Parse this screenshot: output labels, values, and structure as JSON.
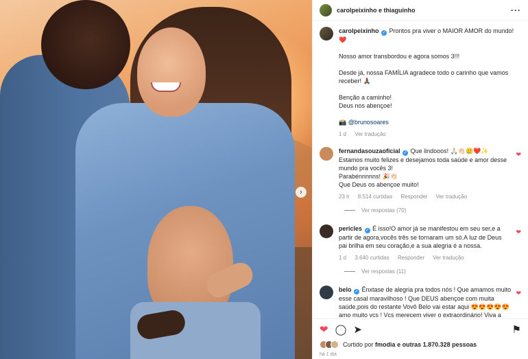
{
  "header": {
    "username": "carolpeixinho e thiaguinho",
    "more": "···"
  },
  "caption": {
    "username": "carolpeixinho",
    "line1": "Prontos pra viver o MAIOR AMOR do mundo!",
    "line1_emoji": "❤️",
    "para2": "Nosso amor transbordou e agora somos 3!!!",
    "para3": "Desde já, nossa FAMÍLIA agradece todo o carinho que vamos receber! 🙏🏾",
    "para4a": "Benção a caminho!",
    "para4b": "Deus nos abençoe!",
    "credit_icon": "📸",
    "credit": "@brunosoares",
    "time": "1 d",
    "see_translation": "Ver tradução"
  },
  "comments": [
    {
      "username": "fernandasouzaoficial",
      "text": "Que lindooos! 🙏🏻👏🏻🥲❤️✨",
      "lines": [
        "Estamos muito felizes e desejamos toda saúde e amor desse mundo pra vocês 3!",
        "Parabénnnnns! 🎉👏🏻",
        "Que Deus os abençoe muito!"
      ],
      "time": "23 h",
      "likes": "8.514 curtidas",
      "reply": "Responder",
      "translate": "Ver tradução",
      "replies": "Ver respostas (70)",
      "avatar_color": "#c98a5c"
    },
    {
      "username": "pericles",
      "text": "É isso!O amor já se manifestou em seu ser,e a partir de agora,vocês três se tornaram um só.A luz de Deus pai brilha em seu coração,e a sua alegria é a nossa.",
      "time": "1 d",
      "likes": "3.640 curtidas",
      "reply": "Responder",
      "translate": "Ver tradução",
      "replies": "Ver respostas (11)",
      "avatar_color": "#3b2b26"
    },
    {
      "username": "belo",
      "text": "Ênxtase de alegria pra todos nós ! Que amamos muito esse casal maravilhoso ! Que DEUS abençoe com muita saúde,pois do restante Vovô Belo vai estar aqui 😍😍😍😍😍 amo muito vcs ! Vcs merecem viver o extraordinário! Viva a família TH e Peixinho ! 😍❤️😍",
      "avatar_color": "#2f3b47"
    }
  ],
  "likes": {
    "prefix": "Curtido por",
    "user": "fmodia",
    "suffix": "e outras 1.870.328 pessoas"
  },
  "posted_ago": "há 1 dia",
  "colors": {
    "accent": "#3897f0",
    "heart": "#ed4956",
    "muted": "#8e8e8e"
  },
  "icons": [
    "heart-icon",
    "comment-icon",
    "share-icon",
    "bookmark-icon",
    "more-icon",
    "chevron-right-icon",
    "verified-icon"
  ]
}
